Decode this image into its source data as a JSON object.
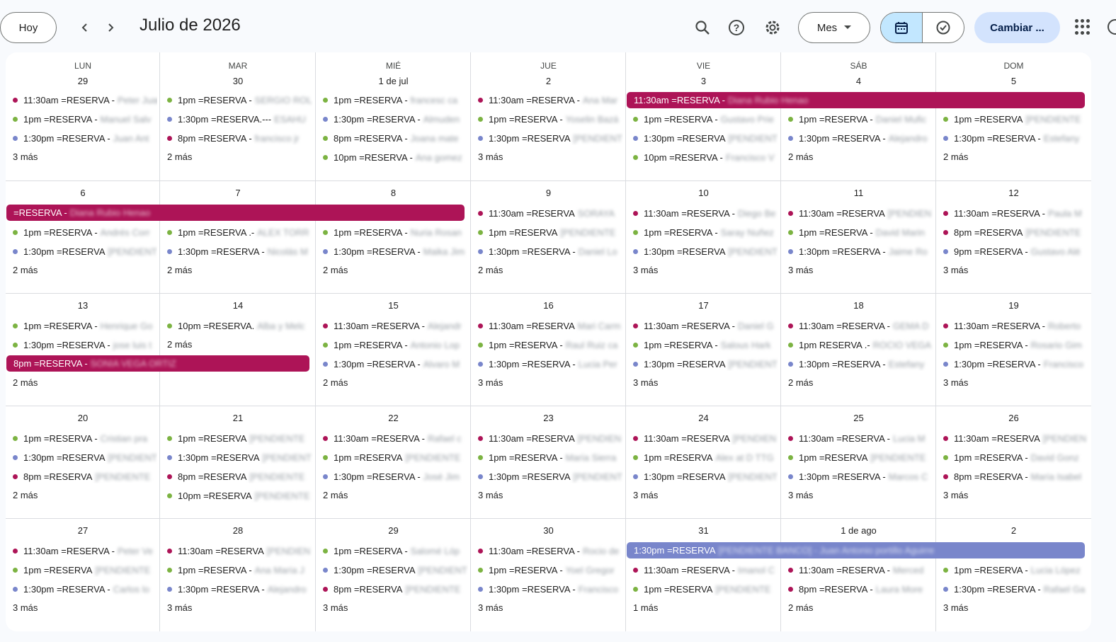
{
  "header": {
    "today_label": "Hoy",
    "prev_icon": "chevron-left-icon",
    "next_icon": "chevron-right-icon",
    "title": "Julio de 2026",
    "search_icon": "search-icon",
    "help_icon": "help-icon",
    "settings_icon": "gear-icon",
    "view_label": "Mes",
    "switch_label": "Cambiar ...",
    "apps_icon": "apps-grid-icon"
  },
  "colors": {
    "magenta": "#ad1457",
    "green": "#7cb342",
    "lavender": "#7986cb",
    "accent": "#c2e7ff"
  },
  "weekdays": [
    "LUN",
    "MAR",
    "MIÉ",
    "JUE",
    "VIE",
    "SÁB",
    "DOM"
  ],
  "weeks": [
    [
      {
        "day": "29",
        "events": [
          {
            "t": "11:30am =RESERVA -",
            "c": "#ad1457",
            "b": "Peter Juan"
          },
          {
            "t": "1pm =RESERVA -",
            "c": "#7cb342",
            "b": "Manuel Salv"
          },
          {
            "t": "1:30pm =RESERVA -",
            "c": "#7986cb",
            "b": "Juan Ant"
          }
        ],
        "more": "3 más"
      },
      {
        "day": "30",
        "events": [
          {
            "t": "1pm =RESERVA -",
            "c": "#7cb342",
            "b": "SERGIO ROL"
          },
          {
            "t": "1:30pm =RESERVA.---",
            "c": "#7986cb",
            "b": "ESAHU"
          },
          {
            "t": "8pm =RESERVA -",
            "c": "#ad1457",
            "b": "francisco jr"
          }
        ],
        "more": "2 más"
      },
      {
        "day": "1 de jul",
        "events": [
          {
            "t": "1pm =RESERVA -",
            "c": "#7cb342",
            "b": "francesc ca"
          },
          {
            "t": "1:30pm =RESERVA -",
            "c": "#7986cb",
            "b": "Almuden"
          },
          {
            "t": "8pm =RESERVA -",
            "c": "#7cb342",
            "b": "Joana mate"
          },
          {
            "t": "10pm =RESERVA -",
            "c": "#7cb342",
            "b": "Ana gomez"
          }
        ],
        "more": ""
      },
      {
        "day": "2",
        "events": [
          {
            "t": "11:30am =RESERVA -",
            "c": "#ad1457",
            "b": "Ana Mar"
          },
          {
            "t": "1pm =RESERVA -",
            "c": "#7cb342",
            "b": "Yoselin Bazá"
          },
          {
            "t": "1:30pm =RESERVA",
            "c": "#7986cb",
            "b": "[PENDIENT"
          }
        ],
        "more": "3 más"
      },
      {
        "day": "3",
        "events": [
          {
            "t": "1pm =RESERVA -",
            "c": "#7cb342",
            "b": "Gustavo Prie"
          },
          {
            "t": "1:30pm =RESERVA",
            "c": "#7986cb",
            "b": "[PENDIENT"
          },
          {
            "t": "10pm =RESERVA -",
            "c": "#7cb342",
            "b": "Francisco V"
          }
        ],
        "more": ""
      },
      {
        "day": "4",
        "events": [
          {
            "t": "1pm =RESERVA -",
            "c": "#7cb342",
            "b": "Daniel Mufic"
          },
          {
            "t": "1:30pm =RESERVA -",
            "c": "#7986cb",
            "b": "Alejandro"
          }
        ],
        "more": "2 más"
      },
      {
        "day": "5",
        "events": [
          {
            "t": "1pm =RESERVA",
            "c": "#7cb342",
            "b": "[PENDIENTE"
          },
          {
            "t": "1:30pm =RESERVA -",
            "c": "#7986cb",
            "b": "Estefany"
          }
        ],
        "more": "2 más"
      }
    ],
    [
      {
        "day": "6",
        "events": [
          {
            "t": "1pm =RESERVA -",
            "c": "#7cb342",
            "b": "Andrés Corr"
          },
          {
            "t": "1:30pm =RESERVA",
            "c": "#7986cb",
            "b": "[PENDIENT"
          }
        ],
        "more": "2 más"
      },
      {
        "day": "7",
        "events": [
          {
            "t": "1pm =RESERVA .-",
            "c": "#7cb342",
            "b": "ALEX TORR"
          },
          {
            "t": "1:30pm =RESERVA -",
            "c": "#7986cb",
            "b": "Nicolás M"
          }
        ],
        "more": "2 más"
      },
      {
        "day": "8",
        "events": [
          {
            "t": "1pm =RESERVA -",
            "c": "#7cb342",
            "b": "Nuria Rosan"
          },
          {
            "t": "1:30pm =RESERVA -",
            "c": "#7986cb",
            "b": "Maika Jim"
          }
        ],
        "more": "2 más"
      },
      {
        "day": "9",
        "events": [
          {
            "t": "11:30am =RESERVA",
            "c": "#ad1457",
            "b": "SORAYA"
          },
          {
            "t": "1pm =RESERVA",
            "c": "#7cb342",
            "b": "[PENDIENTE"
          },
          {
            "t": "1:30pm =RESERVA -",
            "c": "#7986cb",
            "b": "Daniel Lo"
          }
        ],
        "more": "2 más"
      },
      {
        "day": "10",
        "events": [
          {
            "t": "11:30am =RESERVA -",
            "c": "#ad1457",
            "b": "Diego Be"
          },
          {
            "t": "1pm =RESERVA -",
            "c": "#7cb342",
            "b": "Saray Nuñez"
          },
          {
            "t": "1:30pm =RESERVA",
            "c": "#7986cb",
            "b": "[PENDIENT"
          }
        ],
        "more": "3 más"
      },
      {
        "day": "11",
        "events": [
          {
            "t": "11:30am =RESERVA",
            "c": "#ad1457",
            "b": "[PENDIEN"
          },
          {
            "t": "1pm =RESERVA -",
            "c": "#7cb342",
            "b": "David Marin"
          },
          {
            "t": "1:30pm =RESERVA -",
            "c": "#7986cb",
            "b": "Jaime Ro"
          }
        ],
        "more": "3 más"
      },
      {
        "day": "12",
        "events": [
          {
            "t": "11:30am =RESERVA -",
            "c": "#ad1457",
            "b": "Paula M"
          },
          {
            "t": "8pm =RESERVA",
            "c": "#ad1457",
            "b": "[PENDIENTE"
          },
          {
            "t": "9pm =RESERVA -",
            "c": "#7986cb",
            "b": "Gustavo Alé"
          }
        ],
        "more": "3 más"
      }
    ],
    [
      {
        "day": "13",
        "events": [
          {
            "t": "1pm =RESERVA -",
            "c": "#7cb342",
            "b": "Henrique Go"
          },
          {
            "t": "1:30pm =RESERVA -",
            "c": "#7cb342",
            "b": "jose luis t"
          }
        ],
        "more": "2 más"
      },
      {
        "day": "14",
        "events": [
          {
            "t": "10pm =RESERVA.",
            "c": "#7cb342",
            "b": "Alba y Melc"
          }
        ],
        "more": "2 más"
      },
      {
        "day": "15",
        "events": [
          {
            "t": "11:30am =RESERVA -",
            "c": "#ad1457",
            "b": "Alejandr"
          },
          {
            "t": "1pm =RESERVA -",
            "c": "#7cb342",
            "b": "Antonio Lop"
          },
          {
            "t": "1:30pm =RESERVA -",
            "c": "#7986cb",
            "b": "Alvaro M"
          }
        ],
        "more": "2 más"
      },
      {
        "day": "16",
        "events": [
          {
            "t": "11:30am =RESERVA",
            "c": "#ad1457",
            "b": "Mari Carm"
          },
          {
            "t": "1pm =RESERVA -",
            "c": "#7cb342",
            "b": "Raul Ruiz ca"
          },
          {
            "t": "1:30pm =RESERVA -",
            "c": "#7986cb",
            "b": "Lucia Per"
          }
        ],
        "more": "3 más"
      },
      {
        "day": "17",
        "events": [
          {
            "t": "11:30am =RESERVA -",
            "c": "#ad1457",
            "b": "Daniel G"
          },
          {
            "t": "1pm =RESERVA -",
            "c": "#7cb342",
            "b": "Salous Hark"
          },
          {
            "t": "1:30pm =RESERVA",
            "c": "#7986cb",
            "b": "[PENDIENT"
          }
        ],
        "more": "3 más"
      },
      {
        "day": "18",
        "events": [
          {
            "t": "11:30am =RESERVA -",
            "c": "#ad1457",
            "b": "GEMA D"
          },
          {
            "t": "1pm RESERVA .-",
            "c": "#7cb342",
            "b": "ROCIO VEGA"
          },
          {
            "t": "1:30pm =RESERVA -",
            "c": "#7986cb",
            "b": "Estefany"
          }
        ],
        "more": "2 más"
      },
      {
        "day": "19",
        "events": [
          {
            "t": "11:30am =RESERVA -",
            "c": "#ad1457",
            "b": "Roberto"
          },
          {
            "t": "1pm =RESERVA -",
            "c": "#7cb342",
            "b": "Rosario Gim"
          },
          {
            "t": "1:30pm =RESERVA -",
            "c": "#7986cb",
            "b": "Francisco"
          }
        ],
        "more": "3 más"
      }
    ],
    [
      {
        "day": "20",
        "events": [
          {
            "t": "1pm =RESERVA -",
            "c": "#7cb342",
            "b": "Cristian pra"
          },
          {
            "t": "1:30pm =RESERVA",
            "c": "#7986cb",
            "b": "[PENDIENT"
          },
          {
            "t": "8pm =RESERVA",
            "c": "#ad1457",
            "b": "[PENDIENTE"
          }
        ],
        "more": "2 más"
      },
      {
        "day": "21",
        "events": [
          {
            "t": "1pm =RESERVA",
            "c": "#7cb342",
            "b": "[PENDIENTE"
          },
          {
            "t": "1:30pm =RESERVA",
            "c": "#7986cb",
            "b": "[PENDIENT"
          },
          {
            "t": "8pm =RESERVA",
            "c": "#ad1457",
            "b": "[PENDIENTE"
          },
          {
            "t": "10pm =RESERVA",
            "c": "#7cb342",
            "b": "[PENDIENTE"
          }
        ],
        "more": ""
      },
      {
        "day": "22",
        "events": [
          {
            "t": "11:30am =RESERVA -",
            "c": "#ad1457",
            "b": "Rafael c"
          },
          {
            "t": "1pm =RESERVA",
            "c": "#7cb342",
            "b": "[PENDIENTE"
          },
          {
            "t": "1:30pm =RESERVA -",
            "c": "#7986cb",
            "b": "José Jim"
          }
        ],
        "more": "2 más"
      },
      {
        "day": "23",
        "events": [
          {
            "t": "11:30am =RESERVA",
            "c": "#ad1457",
            "b": "[PENDIEN"
          },
          {
            "t": "1pm =RESERVA -",
            "c": "#7cb342",
            "b": "María Sierra"
          },
          {
            "t": "1:30pm =RESERVA",
            "c": "#7986cb",
            "b": "[PENDIENT"
          }
        ],
        "more": "3 más"
      },
      {
        "day": "24",
        "events": [
          {
            "t": "11:30am =RESERVA",
            "c": "#ad1457",
            "b": "[PENDIEN"
          },
          {
            "t": "1pm =RESERVA",
            "c": "#7cb342",
            "b": "Alex at D TTG"
          },
          {
            "t": "1:30pm =RESERVA",
            "c": "#7986cb",
            "b": "[PENDIENT"
          }
        ],
        "more": "3 más"
      },
      {
        "day": "25",
        "events": [
          {
            "t": "11:30am =RESERVA -",
            "c": "#ad1457",
            "b": "Lucia M"
          },
          {
            "t": "1pm =RESERVA",
            "c": "#7cb342",
            "b": "[PENDIENTE"
          },
          {
            "t": "1:30pm =RESERVA -",
            "c": "#7986cb",
            "b": "Marcos C"
          }
        ],
        "more": "3 más"
      },
      {
        "day": "26",
        "events": [
          {
            "t": "11:30am =RESERVA",
            "c": "#ad1457",
            "b": "[PENDIEN"
          },
          {
            "t": "1pm =RESERVA -",
            "c": "#7cb342",
            "b": "David Gonz"
          },
          {
            "t": "8pm =RESERVA -",
            "c": "#ad1457",
            "b": "María Isabel"
          }
        ],
        "more": "3 más"
      }
    ],
    [
      {
        "day": "27",
        "events": [
          {
            "t": "11:30am =RESERVA -",
            "c": "#ad1457",
            "b": "Peter Ve"
          },
          {
            "t": "1pm =RESERVA",
            "c": "#7cb342",
            "b": "[PENDIENTE"
          },
          {
            "t": "1:30pm =RESERVA -",
            "c": "#7986cb",
            "b": "Carlos lo"
          }
        ],
        "more": "3 más"
      },
      {
        "day": "28",
        "events": [
          {
            "t": "11:30am =RESERVA",
            "c": "#ad1457",
            "b": "[PENDIEN"
          },
          {
            "t": "1pm =RESERVA -",
            "c": "#7cb342",
            "b": "Ana María J"
          },
          {
            "t": "1:30pm =RESERVA -",
            "c": "#7986cb",
            "b": "Alejandro"
          }
        ],
        "more": "3 más"
      },
      {
        "day": "29",
        "events": [
          {
            "t": "1pm =RESERVA -",
            "c": "#7cb342",
            "b": "Salomé Lóp"
          },
          {
            "t": "1:30pm =RESERVA",
            "c": "#7986cb",
            "b": "[PENDIENT"
          },
          {
            "t": "8pm =RESERVA",
            "c": "#ad1457",
            "b": "[PENDIENTE"
          }
        ],
        "more": "3 más"
      },
      {
        "day": "30",
        "events": [
          {
            "t": "11:30am =RESERVA -",
            "c": "#ad1457",
            "b": "Rocio de"
          },
          {
            "t": "1pm =RESERVA -",
            "c": "#7cb342",
            "b": "Yoel Gregor"
          },
          {
            "t": "1:30pm =RESERVA -",
            "c": "#7986cb",
            "b": "Francisco"
          }
        ],
        "more": "3 más"
      },
      {
        "day": "31",
        "events": [
          {
            "t": "11:30am =RESERVA -",
            "c": "#ad1457",
            "b": "Imanol C"
          },
          {
            "t": "1pm =RESERVA",
            "c": "#7cb342",
            "b": "[PENDIENTE"
          }
        ],
        "more": "1 más"
      },
      {
        "day": "1 de ago",
        "events": [
          {
            "t": "11:30am =RESERVA -",
            "c": "#ad1457",
            "b": "Merced"
          },
          {
            "t": "8pm =RESERVA -",
            "c": "#ad1457",
            "b": "Laura More"
          }
        ],
        "more": "2 más"
      },
      {
        "day": "2",
        "events": [
          {
            "t": "1pm =RESERVA -",
            "c": "#7cb342",
            "b": "Lucia López"
          },
          {
            "t": "1:30pm =RESERVA -",
            "c": "#7986cb",
            "b": "Rafael Ga"
          }
        ],
        "more": "3 más"
      }
    ]
  ],
  "spanning_bars": [
    {
      "text": "11:30am =RESERVA -",
      "blur": "Diana Rubio Henao",
      "color": "#ad1457",
      "week": 0
    },
    {
      "text": "=RESERVA -",
      "blur": "Diana Rubio Henao",
      "color": "#ad1457",
      "week": 1
    },
    {
      "text": "8pm =RESERVA -",
      "blur": "SONIA VEGA ORTIZ",
      "color": "#ad1457",
      "week": 2
    },
    {
      "text": "1:30pm =RESERVA",
      "blur": "[PENDIENTE BANCO] - Juan Antonio portillo Aguirre",
      "color": "#7986cb",
      "week": 4
    }
  ]
}
